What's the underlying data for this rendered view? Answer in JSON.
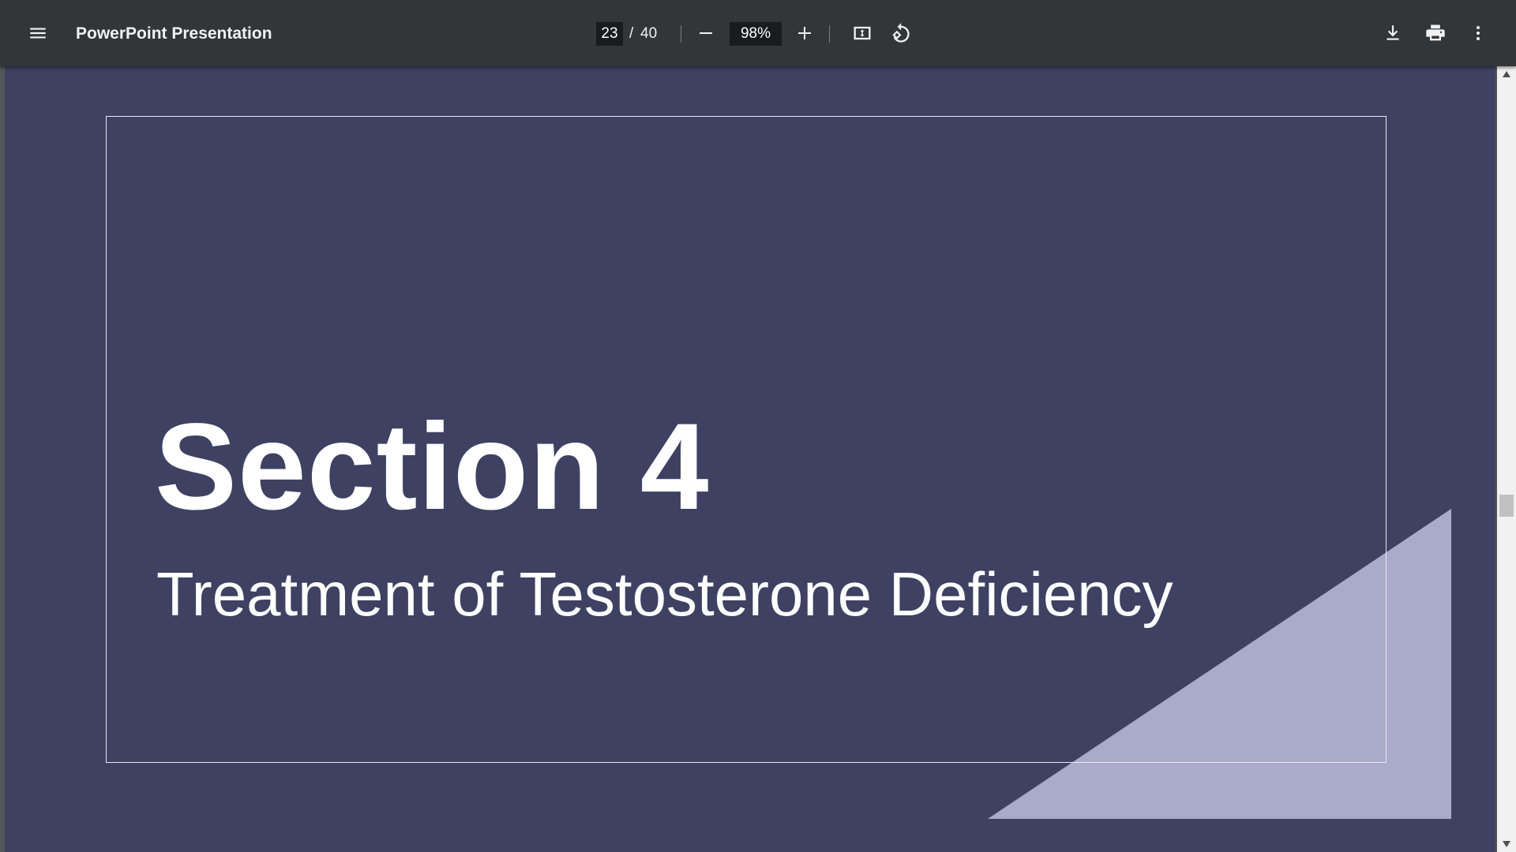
{
  "toolbar": {
    "title": "PowerPoint Presentation",
    "current_page": "23",
    "page_separator": "/",
    "total_pages": "40",
    "zoom": "98%",
    "icons": {
      "menu": "menu-icon",
      "zoom_out": "minus-icon",
      "zoom_in": "plus-icon",
      "fit": "fit-to-page-icon",
      "rotate": "rotate-counterclockwise-icon",
      "download": "download-icon",
      "print": "print-icon",
      "more": "more-vert-icon"
    }
  },
  "slide": {
    "title": "Section 4",
    "subtitle": "Treatment of Testosterone Deficiency",
    "colors": {
      "background": "#3e4162",
      "frame": "#e9e9f0",
      "triangle": "#aaaacb",
      "text": "#ffffff"
    }
  },
  "colors": {
    "toolbar": "#323639",
    "viewer_background": "#525659"
  }
}
